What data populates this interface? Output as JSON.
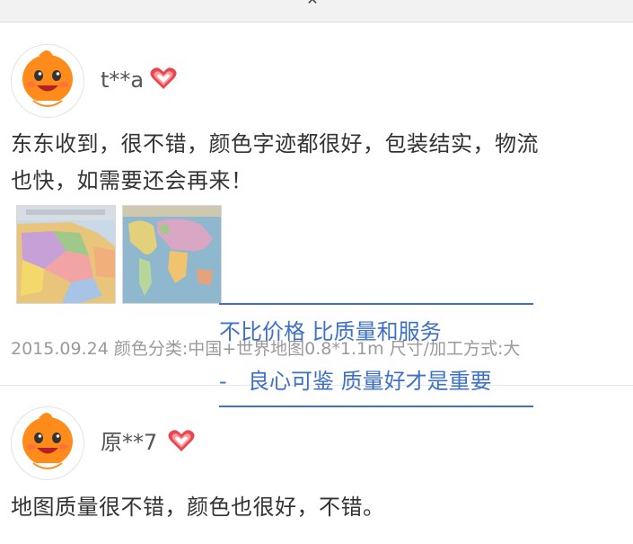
{
  "top_bar": {
    "close_icon": "close-icon"
  },
  "reviews": [
    {
      "username": "t**a",
      "text_line1": "东东收到，很不错，颜色字迹都很好，包装结实，物流",
      "text_line2": "也快，如需要还会再来！",
      "photos": [
        "china-map-photo",
        "world-map-photo"
      ],
      "meta": "2015.09.24 颜色分类:中国+世界地图0.8*1.1m  尺寸/加工方式:大"
    },
    {
      "username": "原**7",
      "text_line1": "地图质量很不错，颜色也很好，不错。"
    }
  ],
  "watermark": {
    "line1": "不比价格 比质量和服务",
    "dash": "-",
    "line2": "良心可鉴 质量好才是重要"
  },
  "colors": {
    "watermark_blue": "#3f70c8",
    "avatar_orange": "#ff8c1a",
    "heart_red": "#e8474f"
  }
}
